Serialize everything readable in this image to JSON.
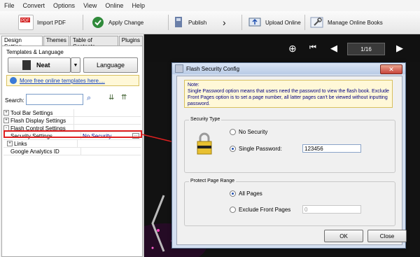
{
  "menu": [
    "File",
    "Convert",
    "Options",
    "View",
    "Online",
    "Help"
  ],
  "toolbar": {
    "import": "Import PDF",
    "apply": "Apply Change",
    "publish": "Publish",
    "upload": "Upload Online",
    "manage": "Manage Online Books"
  },
  "left_panel": {
    "tabs": [
      "Design Setting",
      "Themes",
      "Table of Contents",
      "Plugins"
    ],
    "templates_label": "Templates & Language",
    "template_name": "Neat",
    "language_button": "Language",
    "more_templates": "More free online templates here....",
    "search_label": "Search:",
    "tree": [
      {
        "label": "Tool Bar Settings",
        "indent": 0,
        "toggle": "+",
        "value": ""
      },
      {
        "label": "Flash Display Settings",
        "indent": 0,
        "toggle": "+",
        "value": ""
      },
      {
        "label": "Flash Control Settings",
        "indent": 0,
        "toggle": "-",
        "value": ""
      },
      {
        "label": "Security Settings",
        "indent": 2,
        "toggle": "",
        "value": "No Security"
      },
      {
        "label": "Links",
        "indent": 1,
        "toggle": "+",
        "value": ""
      },
      {
        "label": "Google Analytics ID",
        "indent": 2,
        "toggle": "",
        "value": ""
      }
    ]
  },
  "preview": {
    "page_indicator": "1/16"
  },
  "dialog": {
    "title": "Flash Security Config",
    "note_title": "Note:",
    "note_text": "Single Password option means that users need the password to view the flash book. Exclude Front Pages option is to set a page number, all latter pages can't be viewed without inputting password.",
    "security_type_label": "Security Type",
    "no_security": "No Security",
    "single_password": "Single Password:",
    "password_value": "123456",
    "protect_label": "Protect Page Range",
    "all_pages": "All Pages",
    "exclude_front": "Exclude Front Pages",
    "exclude_value": "0",
    "ok": "OK",
    "close": "Close"
  },
  "colors": {
    "accent": "#2050b0",
    "arrow": "#e02020",
    "highlight_box": "#e02020"
  }
}
